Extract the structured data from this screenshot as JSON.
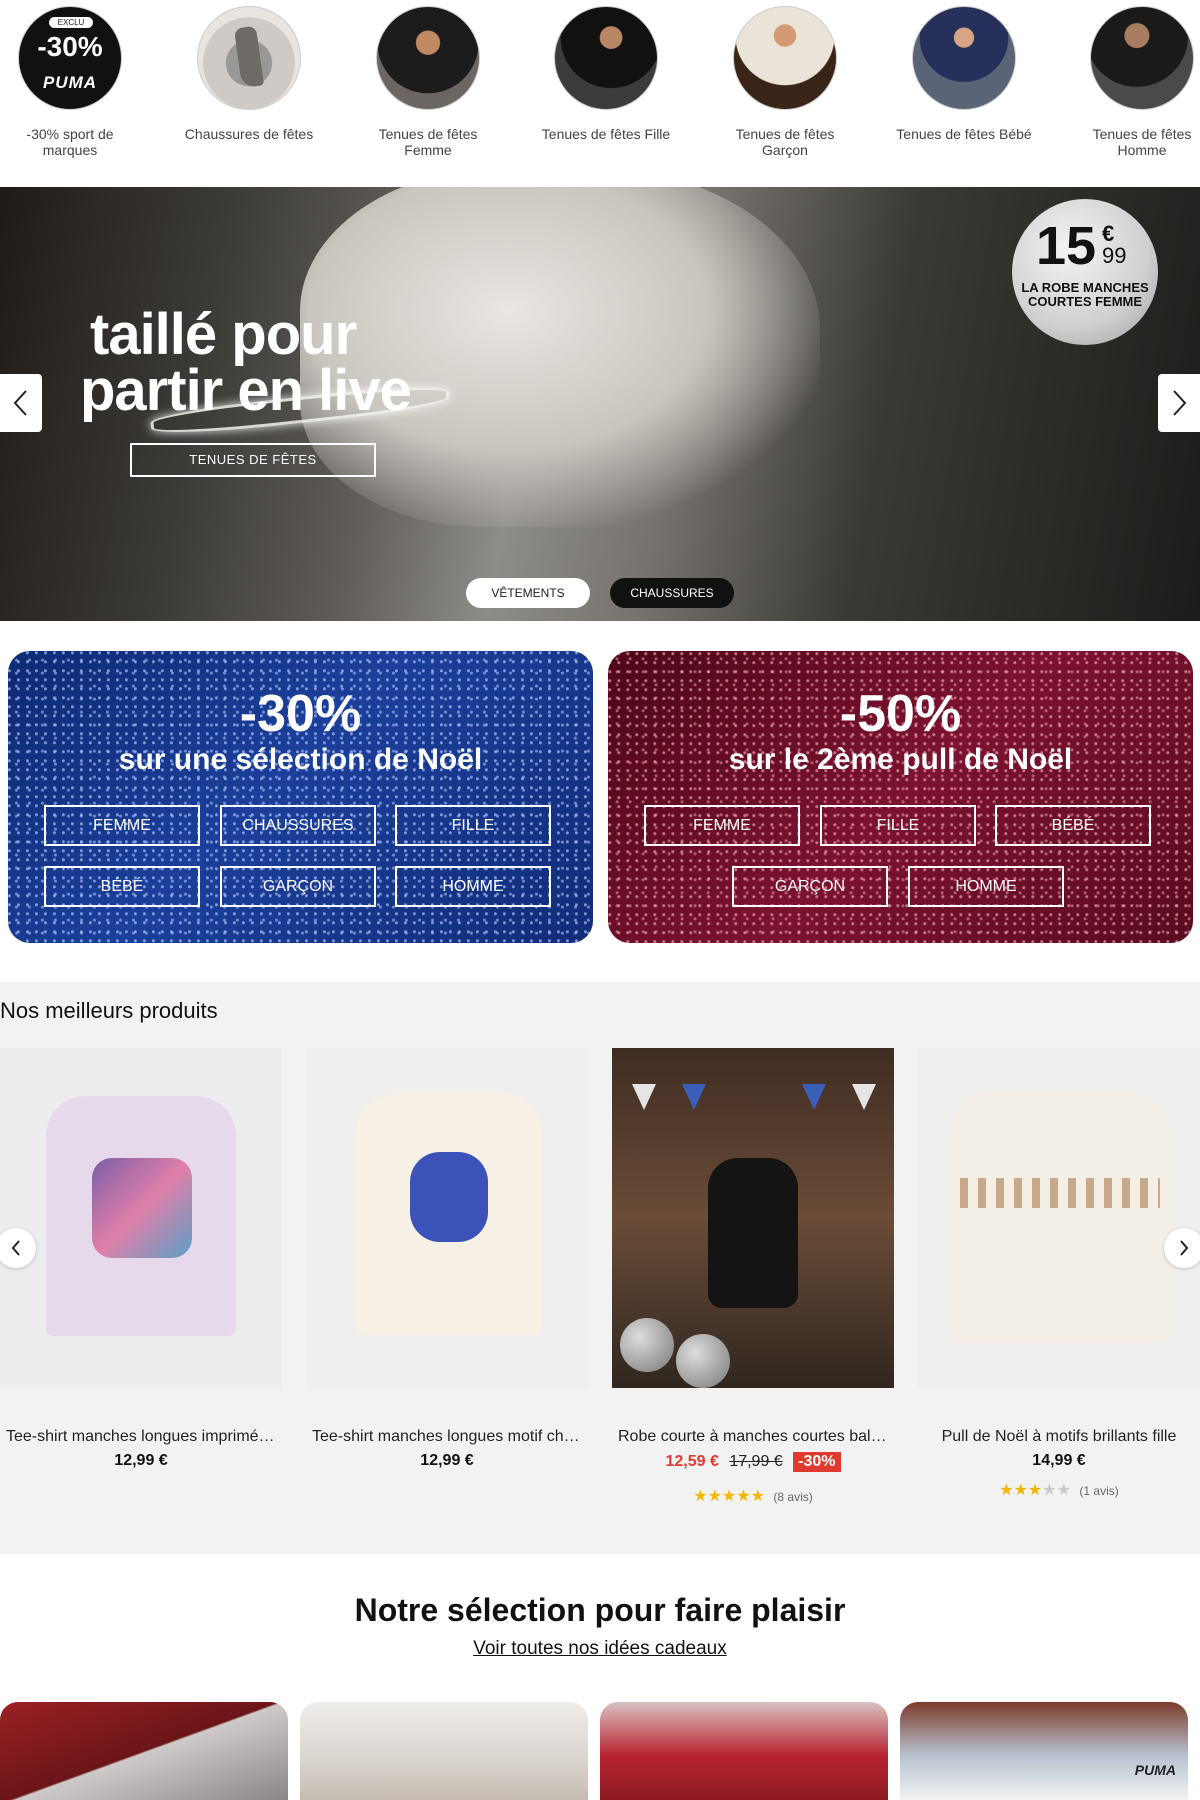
{
  "categories": [
    {
      "label": "-30% sport de marques",
      "badge_top": "EXCLU",
      "badge_big": "-30%",
      "badge_brand": "PUMA"
    },
    {
      "label": "Chaussures de fêtes"
    },
    {
      "label": "Tenues de fêtes Femme"
    },
    {
      "label": "Tenues de fêtes Fille"
    },
    {
      "label": "Tenues de fêtes Garçon"
    },
    {
      "label": "Tenues de fêtes Bébé"
    },
    {
      "label": "Tenues de fêtes Homme"
    }
  ],
  "hero": {
    "headline_line1": "taillé pour",
    "headline_line2": "partir en live",
    "cta": "TENUES DE FÊTES",
    "price_euros": "15",
    "price_currency": "€",
    "price_cents": "99",
    "price_desc": "LA ROBE MANCHES COURTES FEMME",
    "pill_1": "VÊTEMENTS",
    "pill_2": "CHAUSSURES"
  },
  "promos": [
    {
      "percent": "-30%",
      "subtitle": "sur une sélection de Noël",
      "buttons": [
        "FEMME",
        "CHAUSSURES",
        "FILLE",
        "BÉBÉ",
        "GARÇON",
        "HOMME"
      ],
      "color": "#1b3f9a"
    },
    {
      "percent": "-50%",
      "subtitle": "sur le 2ème pull de Noël",
      "buttons": [
        "FEMME",
        "FILLE",
        "BÉBÉ",
        "GARÇON",
        "HOMME"
      ],
      "color": "#7b1230"
    }
  ],
  "best_products": {
    "title": "Nos meilleurs produits",
    "items": [
      {
        "name": "Tee-shirt manches longues imprimé KPOP Demon Hunters",
        "price": "12,99 €"
      },
      {
        "name": "Tee-shirt manches longues motif chat KPOP Demon Hunters",
        "price": "12,99 €"
      },
      {
        "name": "Robe courte à manches courtes ballon",
        "sale_price": "12,59 €",
        "old_price": "17,99 €",
        "discount": "-30%",
        "rating": 4.5,
        "reviews": "(8 avis)"
      },
      {
        "name": "Pull de Noël à motifs brillants fille",
        "price": "14,99 €",
        "rating": 3,
        "reviews": "(1 avis)"
      }
    ]
  },
  "selection": {
    "title": "Notre sélection pour faire plaisir",
    "link": "Voir toutes nos idées cadeaux",
    "brand_text": "PUMA"
  },
  "colors": {
    "sale": "#e03a2e",
    "stars": "#f2b600"
  }
}
